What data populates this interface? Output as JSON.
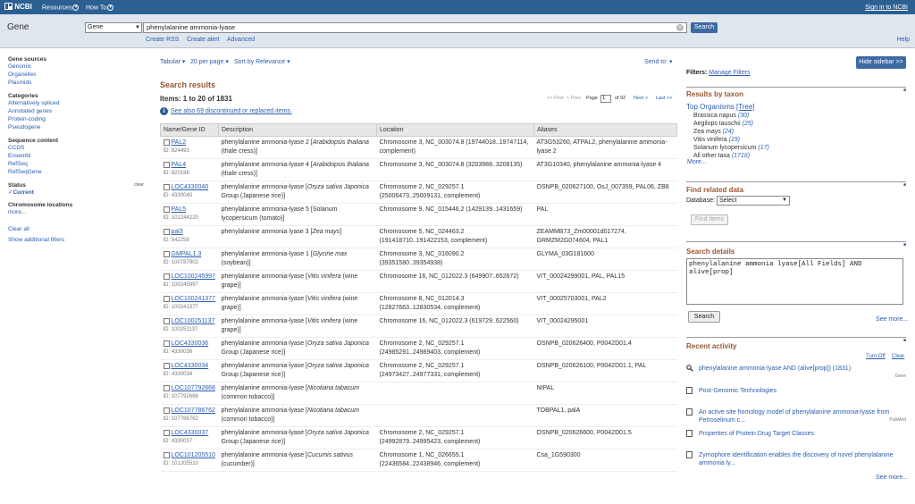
{
  "topbar": {
    "logo": "NCBI",
    "resources": "Resources",
    "howto": "How To",
    "signin": "Sign in to NCBI"
  },
  "search": {
    "app_title": "Gene",
    "db": "Gene",
    "query": "phenylalanine ammonia-lyase",
    "button": "Search",
    "create_rss": "Create RSS",
    "create_alert": "Create alert",
    "advanced": "Advanced",
    "help": "Help"
  },
  "left": {
    "gene_sources": "Gene sources",
    "sources": [
      "Genomic",
      "Organelles",
      "Plasmids"
    ],
    "categories": "Categories",
    "category_items": [
      "Alternatively spliced",
      "Annotated genes",
      "Protein-coding",
      "Pseudogene"
    ],
    "sequence_content": "Sequence content",
    "seq_items": [
      "CCDS",
      "Ensembl",
      "RefSeq",
      "RefSeqGene"
    ],
    "status": "Status",
    "status_clear": "clear",
    "status_current": "Current",
    "chrom_locations": "Chromosome locations",
    "more": "more...",
    "clear_all": "Clear all",
    "show_filters": "Show additional filters"
  },
  "toolbar": {
    "format": "Tabular",
    "per_page": "20 per page",
    "sort": "Sort by Relevance",
    "send_to": "Send to:"
  },
  "results": {
    "title": "Search results",
    "items": "Items: 1 to 20 of 1831",
    "first": "<< First",
    "prev": "< Prev",
    "page_label": "Page",
    "page_value": "1",
    "of": "of 92",
    "next": "Next >",
    "last": "Last >>",
    "discontinued": "See also 69 discontinued or replaced items.",
    "columns": [
      "Name/Gene ID",
      "Description",
      "Location",
      "Aliases"
    ],
    "rows": [
      {
        "name": "PAL2",
        "id": "ID: 824493",
        "desc1": "phenylalanine ammonia-lyase 2 [Arabidopsis thaliana",
        "desc2": "(thale cress)]",
        "loc1": "Chromosome 3, NC_003074.8 (19744018..19747114,",
        "loc2": "complement)",
        "alias1": "AT3G53260, ATPAL2, phenylalanine ammonia-",
        "alias2": "lyase 2"
      },
      {
        "name": "PAL4",
        "id": "ID: 820196",
        "desc1": "phenylalanine ammonia-lyase 4 [Arabidopsis thaliana",
        "desc2": "(thale cress)]",
        "loc1": "Chromosome 3, NC_003074.8 (3203988..3208135)",
        "loc2": "",
        "alias1": "AT3G10340, phenylalanine ammonia-lyase 4",
        "alias2": ""
      },
      {
        "name": "LOC4330040",
        "id": "ID: 4330040",
        "desc1": "phenylalanine ammonia-lyase [Oryza sativa Japonica",
        "desc2": "Group (Japanese rice)]",
        "loc1": "Chromosome 2, NC_029257.1",
        "loc2": "(25006473..25009131, complement)",
        "alias1": "OSNPB_020627100, OsJ_007359, PAL06, ZB8",
        "alias2": ""
      },
      {
        "name": "PAL5",
        "id": "ID: 101244220",
        "desc1": "phenylalanine ammonia-lyase 5 [Solanum",
        "desc2": "lycopersicum (tomato)]",
        "loc1": "Chromosome 9, NC_015446.2 (1429139..1431659)",
        "loc2": "",
        "alias1": "PAL",
        "alias2": ""
      },
      {
        "name": "pal3",
        "id": "ID: 542258",
        "desc1": "phenylalanine ammonia lyase 3 [Zea mays]",
        "desc2": "",
        "loc1": "Chromosome 5, NC_024463.2",
        "loc2": "(191418710..191422153, complement)",
        "alias1": "ZEAMMB73_Zm00001d017274,",
        "alias2": "GRMZM2G074604, PAL1"
      },
      {
        "name": "GMPAL1.3",
        "id": "ID: 100787902",
        "desc1": "phenylalanine ammonia-lyase 1 [Glycine max",
        "desc2": "(soybean)]",
        "loc1": "Chromosome 3, NC_016090.2",
        "loc2": "(39351580..39354938)",
        "alias1": "GLYMA_03G181600",
        "alias2": ""
      },
      {
        "name": "LOC100245997",
        "id": "ID: 100245997",
        "desc1": "phenylalanine ammonia-lyase [Vitis vinifera (wine",
        "desc2": "grape)]",
        "loc1": "Chromosome 16, NC_012022.3 (649907..652672)",
        "loc2": "",
        "alias1": "VIT_00024299001, PAL, PAL15",
        "alias2": ""
      },
      {
        "name": "LOC100241377",
        "id": "ID: 100241377",
        "desc1": "phenylalanine ammonia-lyase [Vitis vinifera (wine",
        "desc2": "grape)]",
        "loc1": "Chromosome 8, NC_012014.3",
        "loc2": "(12827663..12830534, complement)",
        "alias1": "VIT_00025703001, PAL2",
        "alias2": ""
      },
      {
        "name": "LOC100251137",
        "id": "ID: 100251137",
        "desc1": "phenylalanine ammonia-lyase [Vitis vinifera (wine",
        "desc2": "grape)]",
        "loc1": "Chromosome 16, NC_012022.3 (619729..622560)",
        "loc2": "",
        "alias1": "VIT_00024295001",
        "alias2": ""
      },
      {
        "name": "LOC4330036",
        "id": "ID: 4330036",
        "desc1": "phenylalanine ammonia-lyase [Oryza sativa Japonica",
        "desc2": "Group (Japanese rice)]",
        "loc1": "Chromosome 2, NC_029257.1",
        "loc2": "(24985291..24989403, complement)",
        "alias1": "OSNPB_020626400, P0042D01.4",
        "alias2": ""
      },
      {
        "name": "LOC4330034",
        "id": "ID: 4330034",
        "desc1": "phenylalanine ammonia-lyase [Oryza sativa Japonica",
        "desc2": "Group (Japanese rice)]",
        "loc1": "Chromosome 2, NC_029257.1",
        "loc2": "(24973427..24977331, complement)",
        "alias1": "OSNPB_020626100, P0042D01.1, PAL",
        "alias2": ""
      },
      {
        "name": "LOC107792668",
        "id": "ID: 107792668",
        "desc1": "phenylalanine ammonia-lyase [Nicotiana tabacum",
        "desc2": "(common tobacco)]",
        "loc1": "",
        "loc2": "",
        "alias1": "NtPAL",
        "alias2": ""
      },
      {
        "name": "LOC107786762",
        "id": "ID: 107786762",
        "desc1": "phenylalanine ammonia-lyase [Nicotiana tabacum",
        "desc2": "(common tobacco)]",
        "loc1": "",
        "loc2": "",
        "alias1": "TOBPAL1, palA",
        "alias2": ""
      },
      {
        "name": "LOC4330037",
        "id": "ID: 4330037",
        "desc1": "phenylalanine ammonia-lyase [Oryza sativa Japonica",
        "desc2": "Group (Japanese rice)]",
        "loc1": "Chromosome 2, NC_029257.1",
        "loc2": "(24992879..24995423, complement)",
        "alias1": "OSNPB_020626600, P0042D01.5",
        "alias2": ""
      },
      {
        "name": "LOC101205510",
        "id": "ID: 101205510",
        "desc1": "phenylalanine ammonia-lyase [Cucumis sativus",
        "desc2": "(cucumber)]",
        "loc1": "Chromosome 1, NC_026655.1",
        "loc2": "(22436584..22438946, complement)",
        "alias1": "Csa_1G590300",
        "alias2": ""
      }
    ]
  },
  "sidebar": {
    "hide": "Hide sidebar >>",
    "filters_label": "Filters:",
    "manage_filters": "Manage Filters",
    "results_by_taxon": "Results by taxon",
    "top_organisms": "Top Organisms",
    "tree": "[Tree]",
    "taxa": [
      {
        "name": "Brassica napus",
        "count": "(30)"
      },
      {
        "name": "Aegilops tauschii",
        "count": "(25)"
      },
      {
        "name": "Zea mays",
        "count": "(24)"
      },
      {
        "name": "Vitis vinifera",
        "count": "(19)"
      },
      {
        "name": "Solanum lycopersicum",
        "count": "(17)"
      },
      {
        "name": "All other taxa",
        "count": "(1716)"
      }
    ],
    "taxa_more": "More...",
    "find_related": "Find related data",
    "database_label": "Database:",
    "database_value": "Select",
    "find_items": "Find items",
    "search_details": "Search details",
    "details_query": "phenylalanine ammonia lyase[All Fields] AND alive[prop]",
    "details_search": "Search",
    "see_more": "See more...",
    "recent_activity": "Recent activity",
    "turn_off": "Turn Off",
    "clear": "Clear",
    "activity": [
      {
        "text": "phenylalanine ammonia-lyase AND (alive[prop]) (1831)",
        "src": "Gene",
        "icon": "search"
      },
      {
        "text": "Post-Genomic Technologies",
        "src": "",
        "icon": "doc"
      },
      {
        "text": "An active site homology model of phenylalanine ammonia-lyase from Petroselinum c...",
        "src": "PubMed",
        "icon": "doc"
      },
      {
        "text": "Properties of Protein Drug Target Classes",
        "src": "",
        "icon": "doc"
      },
      {
        "text": "Zymophore identification enables the discovery of novel phenylalanine ammonia ly...",
        "src": "",
        "icon": "doc"
      }
    ],
    "activity_more": "See more..."
  }
}
